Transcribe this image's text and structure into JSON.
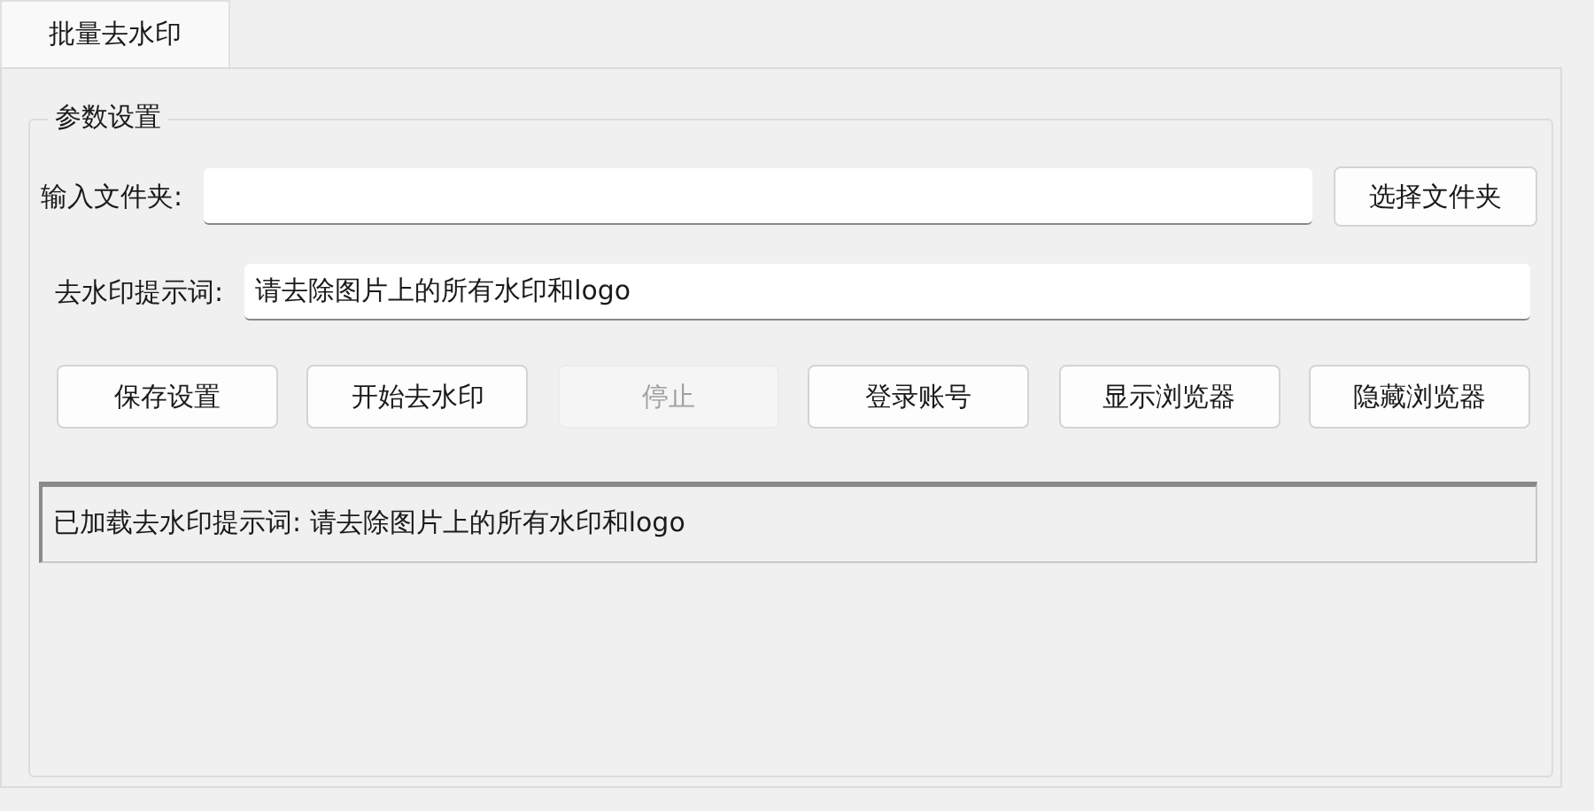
{
  "tabs": [
    {
      "label": "批量去水印",
      "selected": true
    }
  ],
  "group": {
    "title": "参数设置",
    "folder": {
      "label": "输入文件夹:",
      "button": "选择文件夹"
    },
    "prompt": {
      "label": "去水印提示词:",
      "value": "请去除图片上的所有水印和logo"
    },
    "buttons": [
      {
        "label": "保存设置",
        "disabled": false
      },
      {
        "label": "开始去水印",
        "disabled": false
      },
      {
        "label": "停止",
        "disabled": true
      },
      {
        "label": "登录账号",
        "disabled": false
      },
      {
        "label": "显示浏览器",
        "disabled": false
      },
      {
        "label": "隐藏浏览器",
        "disabled": false
      }
    ],
    "log": [
      "已加载去水印提示词: 请去除图片上的所有水印和logo"
    ]
  }
}
